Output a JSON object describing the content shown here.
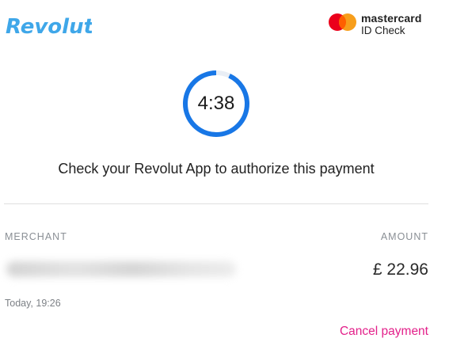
{
  "header": {
    "brand_logo_text": "Revolut",
    "brand_color": "#3fa7e9",
    "mastercard_name": "mastercard",
    "mastercard_sub": "ID Check",
    "mastercard_colors": [
      "#eb001b",
      "#f79e1b",
      "#ff5f00"
    ]
  },
  "timer": {
    "value": "4:38",
    "ring_color": "#1877e6",
    "remaining_fraction": 0.93
  },
  "instruction": "Check your Revolut App to authorize this payment",
  "details": {
    "merchant_label": "MERCHANT",
    "amount_label": "AMOUNT",
    "amount": "£ 22.96",
    "date": "Today, 19:26"
  },
  "actions": {
    "cancel_label": "Cancel payment",
    "cancel_color": "#e3208a"
  }
}
